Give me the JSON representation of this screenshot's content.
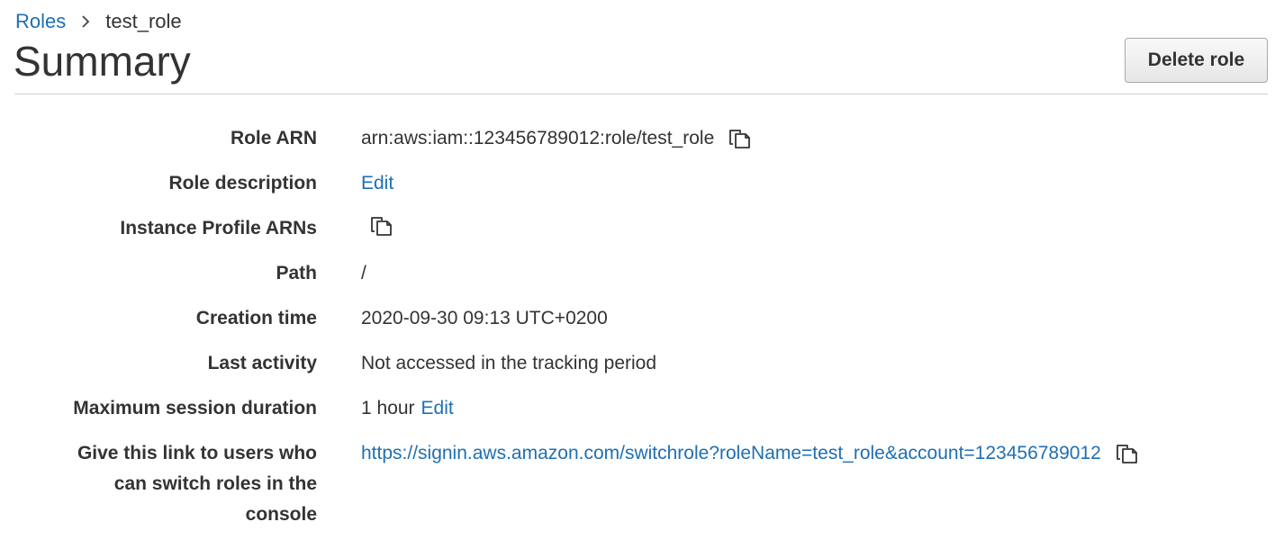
{
  "breadcrumb": {
    "parent": "Roles",
    "current": "test_role"
  },
  "page": {
    "title": "Summary",
    "delete_button": "Delete role"
  },
  "details": {
    "role_arn": {
      "label": "Role ARN",
      "value": "arn:aws:iam::123456789012:role/test_role"
    },
    "role_description": {
      "label": "Role description",
      "edit": "Edit"
    },
    "instance_profile_arns": {
      "label": "Instance Profile ARNs"
    },
    "path": {
      "label": "Path",
      "value": "/"
    },
    "creation_time": {
      "label": "Creation time",
      "value": "2020-09-30 09:13 UTC+0200"
    },
    "last_activity": {
      "label": "Last activity",
      "value": "Not accessed in the tracking period"
    },
    "max_session": {
      "label": "Maximum session duration",
      "value": "1 hour",
      "edit": "Edit"
    },
    "switch_link": {
      "label_line1": "Give this link to users who",
      "label_line2": "can switch roles in the",
      "label_line3": "console",
      "value": "https://signin.aws.amazon.com/switchrole?roleName=test_role&account=123456789012"
    }
  },
  "icons": {
    "copy": "copy-icon",
    "breadcrumb_separator": "chevron-right-icon"
  },
  "colors": {
    "link": "#1f6fb2",
    "text": "#333333"
  }
}
